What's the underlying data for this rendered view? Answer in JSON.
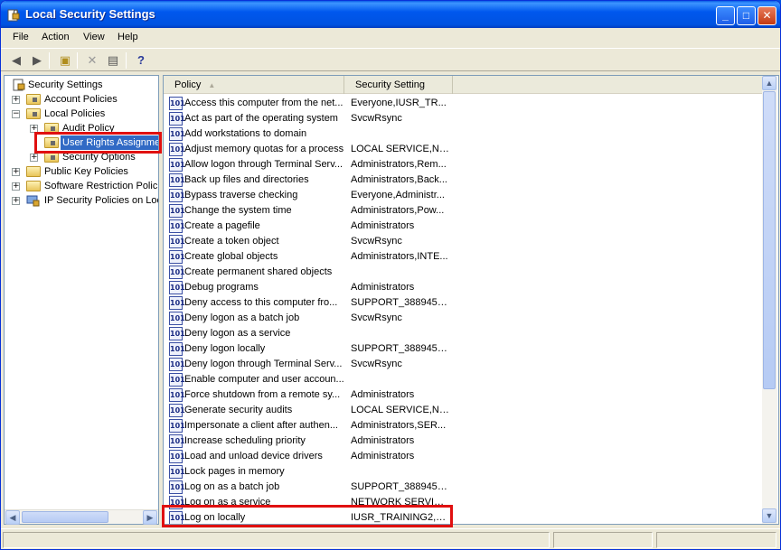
{
  "window": {
    "title": "Local Security Settings"
  },
  "title_buttons": {
    "minimize": "_",
    "maximize": "□",
    "close": "✕"
  },
  "menu": [
    {
      "label": "File"
    },
    {
      "label": "Action"
    },
    {
      "label": "View"
    },
    {
      "label": "Help"
    }
  ],
  "toolbar": [
    "back-icon",
    "forward-icon",
    "up-folder-icon",
    "delete-icon",
    "properties-icon",
    "help-icon"
  ],
  "tree": {
    "items": [
      {
        "label": "Security Settings",
        "expander": ""
      },
      {
        "label": "Account Policies",
        "expander": "+"
      },
      {
        "label": "Local Policies",
        "expander": "−"
      },
      {
        "label": "Audit Policy",
        "expander": "+"
      },
      {
        "label": "User Rights Assignment",
        "expander": "",
        "selected": true
      },
      {
        "label": "Security Options",
        "expander": "+"
      },
      {
        "label": "Public Key Policies",
        "expander": "+"
      },
      {
        "label": "Software Restriction Policies",
        "expander": "+"
      },
      {
        "label": "IP Security Policies on Local Computer",
        "expander": "+"
      }
    ]
  },
  "list": {
    "columns": {
      "policy": "Policy",
      "setting": "Security Setting"
    },
    "rows": [
      {
        "policy": "Access this computer from the net...",
        "setting": "Everyone,IUSR_TR..."
      },
      {
        "policy": "Act as part of the operating system",
        "setting": "SvcwRsync"
      },
      {
        "policy": "Add workstations to domain",
        "setting": ""
      },
      {
        "policy": "Adjust memory quotas for a process",
        "setting": "LOCAL SERVICE,NE..."
      },
      {
        "policy": "Allow logon through Terminal Serv...",
        "setting": "Administrators,Rem..."
      },
      {
        "policy": "Back up files and directories",
        "setting": "Administrators,Back..."
      },
      {
        "policy": "Bypass traverse checking",
        "setting": "Everyone,Administr..."
      },
      {
        "policy": "Change the system time",
        "setting": "Administrators,Pow..."
      },
      {
        "policy": "Create a pagefile",
        "setting": "Administrators"
      },
      {
        "policy": "Create a token object",
        "setting": "SvcwRsync"
      },
      {
        "policy": "Create global objects",
        "setting": "Administrators,INTE..."
      },
      {
        "policy": "Create permanent shared objects",
        "setting": ""
      },
      {
        "policy": "Debug programs",
        "setting": "Administrators"
      },
      {
        "policy": "Deny access to this computer fro...",
        "setting": "SUPPORT_388945a..."
      },
      {
        "policy": "Deny logon as a batch job",
        "setting": "SvcwRsync"
      },
      {
        "policy": "Deny logon as a service",
        "setting": ""
      },
      {
        "policy": "Deny logon locally",
        "setting": "SUPPORT_388945a..."
      },
      {
        "policy": "Deny logon through Terminal Serv...",
        "setting": "SvcwRsync"
      },
      {
        "policy": "Enable computer and user accoun...",
        "setting": ""
      },
      {
        "policy": "Force shutdown from a remote sy...",
        "setting": "Administrators"
      },
      {
        "policy": "Generate security audits",
        "setting": "LOCAL SERVICE,NE..."
      },
      {
        "policy": "Impersonate a client after authen...",
        "setting": "Administrators,SER..."
      },
      {
        "policy": "Increase scheduling priority",
        "setting": "Administrators"
      },
      {
        "policy": "Load and unload device drivers",
        "setting": "Administrators"
      },
      {
        "policy": "Lock pages in memory",
        "setting": ""
      },
      {
        "policy": "Log on as a batch job",
        "setting": "SUPPORT_388945a..."
      },
      {
        "policy": "Log on as a service",
        "setting": "NETWORK SERVICE..."
      },
      {
        "policy": "Log on locally",
        "setting": "IUSR_TRAINING2,G..."
      }
    ]
  },
  "highlight_color": "#e01010",
  "selection_color": "#316ac5"
}
